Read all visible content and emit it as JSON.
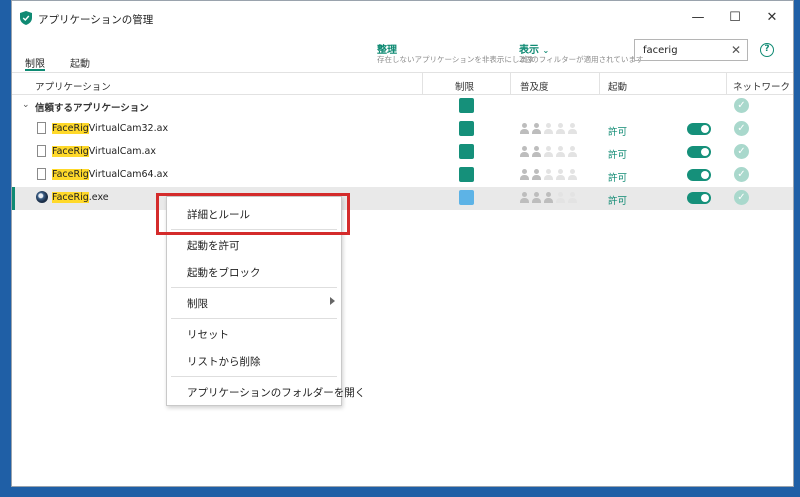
{
  "window": {
    "title": "アプリケーションの管理",
    "minimize_icon": "minimize-icon",
    "maximize_icon": "maximize-icon",
    "close_icon": "close-icon"
  },
  "tabs": [
    {
      "label": "制限",
      "active": true
    },
    {
      "label": "起動",
      "active": false
    }
  ],
  "toolbar": {
    "organize_title": "整理",
    "organize_sub": "存在しないアプリケーションを非表示にします",
    "view_title": "表示",
    "view_sub": "2個のフィルターが適用されています",
    "search_value": "facerig",
    "accent": "#0f8a73"
  },
  "columns": [
    "アプリケーション",
    "制限",
    "普及度",
    "起動",
    "ネットワーク"
  ],
  "group": {
    "label": "信頼するアプリケーション"
  },
  "rows": [
    {
      "highlight": "FaceRig",
      "rest": "VirtualCam32.ax",
      "launch": "許可",
      "popularity": 2,
      "selected": false
    },
    {
      "highlight": "FaceRig",
      "rest": "VirtualCam.ax",
      "launch": "許可",
      "popularity": 2,
      "selected": false
    },
    {
      "highlight": "FaceRig",
      "rest": "VirtualCam64.ax",
      "launch": "許可",
      "popularity": 2,
      "selected": false
    },
    {
      "highlight": "FaceRig",
      "rest": ".exe",
      "launch": "許可",
      "popularity": 3,
      "selected": true
    }
  ],
  "context_menu": {
    "details": "詳細とルール",
    "allow_launch": "起動を許可",
    "block_launch": "起動をブロック",
    "restriction": "制限",
    "reset": "リセット",
    "remove": "リストから削除",
    "open_folder": "アプリケーションのフォルダーを開く"
  }
}
